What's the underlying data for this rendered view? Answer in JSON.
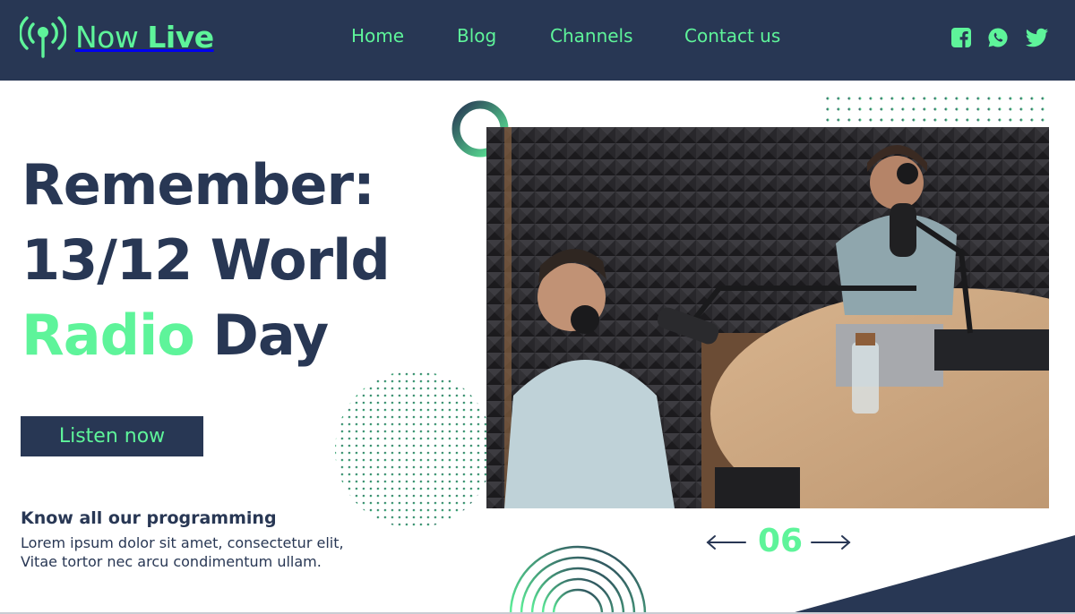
{
  "colors": {
    "navy": "#283754",
    "accent": "#5ef49a",
    "white": "#ffffff"
  },
  "brand": {
    "name_light": "Now",
    "name_bold": "Live",
    "icon": "radio-antenna-icon"
  },
  "nav": {
    "items": [
      "Home",
      "Blog",
      "Channels",
      "Contact us"
    ]
  },
  "social": [
    {
      "icon": "facebook-icon"
    },
    {
      "icon": "whatsapp-icon"
    },
    {
      "icon": "twitter-icon"
    }
  ],
  "hero": {
    "line1": "Remember:",
    "line2": "13/12 World",
    "line3_accent": "Radio",
    "line3_rest": "Day",
    "cta_label": "Listen now",
    "programming_title": "Know all our programming",
    "programming_text_line1": "Lorem ipsum dolor sit amet, consectetur elit,",
    "programming_text_line2": "Vitae tortor nec arcu condimentum ullam."
  },
  "slider": {
    "current": "06",
    "prev_icon": "arrow-left-icon",
    "next_icon": "arrow-right-icon"
  }
}
